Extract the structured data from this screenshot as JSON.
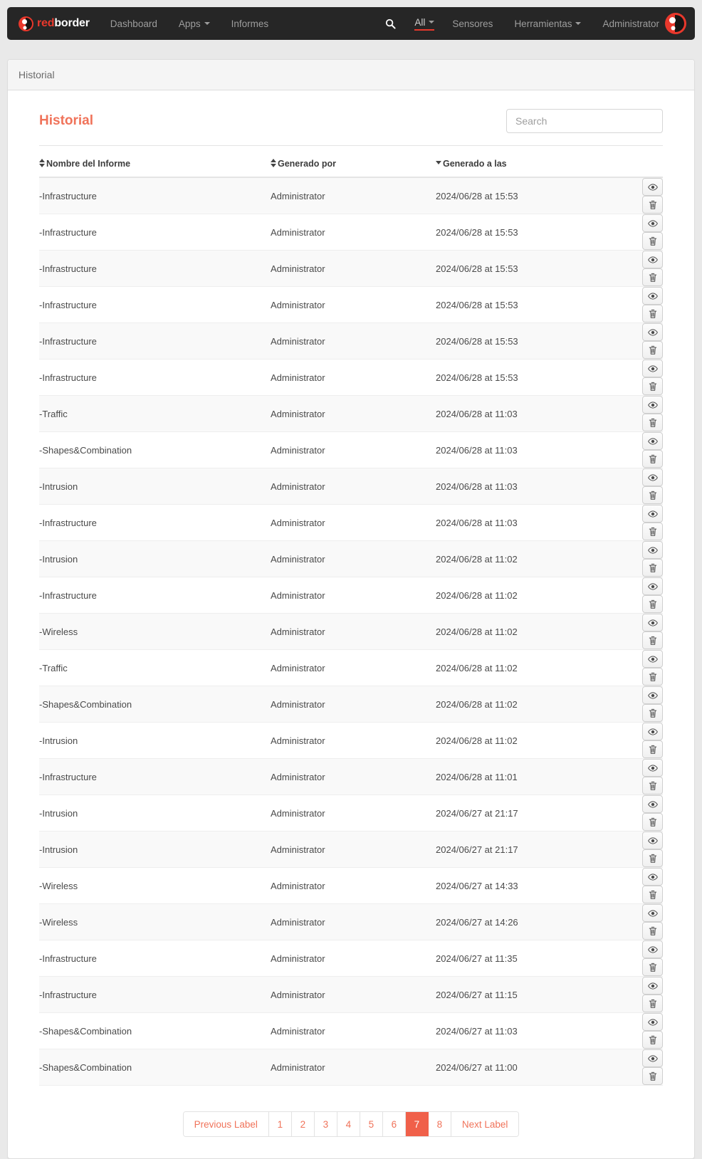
{
  "navbar": {
    "brand": {
      "red": "red",
      "white": "border",
      "icon": "redborder-logo-icon"
    },
    "items": [
      {
        "label": "Dashboard",
        "caret": false
      },
      {
        "label": "Apps",
        "caret": true
      },
      {
        "label": "Informes",
        "caret": false
      }
    ],
    "search_icon": "search-icon",
    "scope": {
      "label": "All",
      "caret": true
    },
    "right_items": [
      {
        "label": "Sensores",
        "caret": false
      },
      {
        "label": "Herramientas",
        "caret": true
      }
    ],
    "user": "Administrator",
    "avatar_icon": "user-avatar-icon",
    "accent": "#e8382c"
  },
  "panel": {
    "heading": "Historial"
  },
  "page": {
    "title": "Historial",
    "title_color": "#f0735a"
  },
  "search": {
    "placeholder": "Search",
    "value": ""
  },
  "table": {
    "columns": [
      {
        "label": "Nombre del Informe",
        "sort": "both"
      },
      {
        "label": "Generado por",
        "sort": "both"
      },
      {
        "label": "Generado a las",
        "sort": "desc"
      },
      {
        "label": "",
        "sort": "none"
      }
    ],
    "row_actions": [
      {
        "name": "view-button",
        "icon": "eye-icon"
      },
      {
        "name": "delete-button",
        "icon": "trash-icon"
      }
    ],
    "rows": [
      {
        "name": "-Infrastructure",
        "user": "Administrator",
        "date": "2024/06/28 at 15:53"
      },
      {
        "name": "-Infrastructure",
        "user": "Administrator",
        "date": "2024/06/28 at 15:53"
      },
      {
        "name": "-Infrastructure",
        "user": "Administrator",
        "date": "2024/06/28 at 15:53"
      },
      {
        "name": "-Infrastructure",
        "user": "Administrator",
        "date": "2024/06/28 at 15:53"
      },
      {
        "name": "-Infrastructure",
        "user": "Administrator",
        "date": "2024/06/28 at 15:53"
      },
      {
        "name": "-Infrastructure",
        "user": "Administrator",
        "date": "2024/06/28 at 15:53"
      },
      {
        "name": "-Traffic",
        "user": "Administrator",
        "date": "2024/06/28 at 11:03"
      },
      {
        "name": "-Shapes&Combination",
        "user": "Administrator",
        "date": "2024/06/28 at 11:03"
      },
      {
        "name": "-Intrusion",
        "user": "Administrator",
        "date": "2024/06/28 at 11:03"
      },
      {
        "name": "-Infrastructure",
        "user": "Administrator",
        "date": "2024/06/28 at 11:03"
      },
      {
        "name": "-Intrusion",
        "user": "Administrator",
        "date": "2024/06/28 at 11:02"
      },
      {
        "name": "-Infrastructure",
        "user": "Administrator",
        "date": "2024/06/28 at 11:02"
      },
      {
        "name": "-Wireless",
        "user": "Administrator",
        "date": "2024/06/28 at 11:02"
      },
      {
        "name": "-Traffic",
        "user": "Administrator",
        "date": "2024/06/28 at 11:02"
      },
      {
        "name": "-Shapes&Combination",
        "user": "Administrator",
        "date": "2024/06/28 at 11:02"
      },
      {
        "name": "-Intrusion",
        "user": "Administrator",
        "date": "2024/06/28 at 11:02"
      },
      {
        "name": "-Infrastructure",
        "user": "Administrator",
        "date": "2024/06/28 at 11:01"
      },
      {
        "name": "-Intrusion",
        "user": "Administrator",
        "date": "2024/06/27 at 21:17"
      },
      {
        "name": "-Intrusion",
        "user": "Administrator",
        "date": "2024/06/27 at 21:17"
      },
      {
        "name": "-Wireless",
        "user": "Administrator",
        "date": "2024/06/27 at 14:33"
      },
      {
        "name": "-Wireless",
        "user": "Administrator",
        "date": "2024/06/27 at 14:26"
      },
      {
        "name": "-Infrastructure",
        "user": "Administrator",
        "date": "2024/06/27 at 11:35"
      },
      {
        "name": "-Infrastructure",
        "user": "Administrator",
        "date": "2024/06/27 at 11:15"
      },
      {
        "name": "-Shapes&Combination",
        "user": "Administrator",
        "date": "2024/06/27 at 11:03"
      },
      {
        "name": "-Shapes&Combination",
        "user": "Administrator",
        "date": "2024/06/27 at 11:00"
      }
    ]
  },
  "pagination": {
    "previous_label": "Previous Label",
    "next_label": "Next Label",
    "pages": [
      "1",
      "2",
      "3",
      "4",
      "5",
      "6",
      "7",
      "8"
    ],
    "active": "7",
    "active_color": "#f0604a",
    "link_color": "#f0735a"
  }
}
